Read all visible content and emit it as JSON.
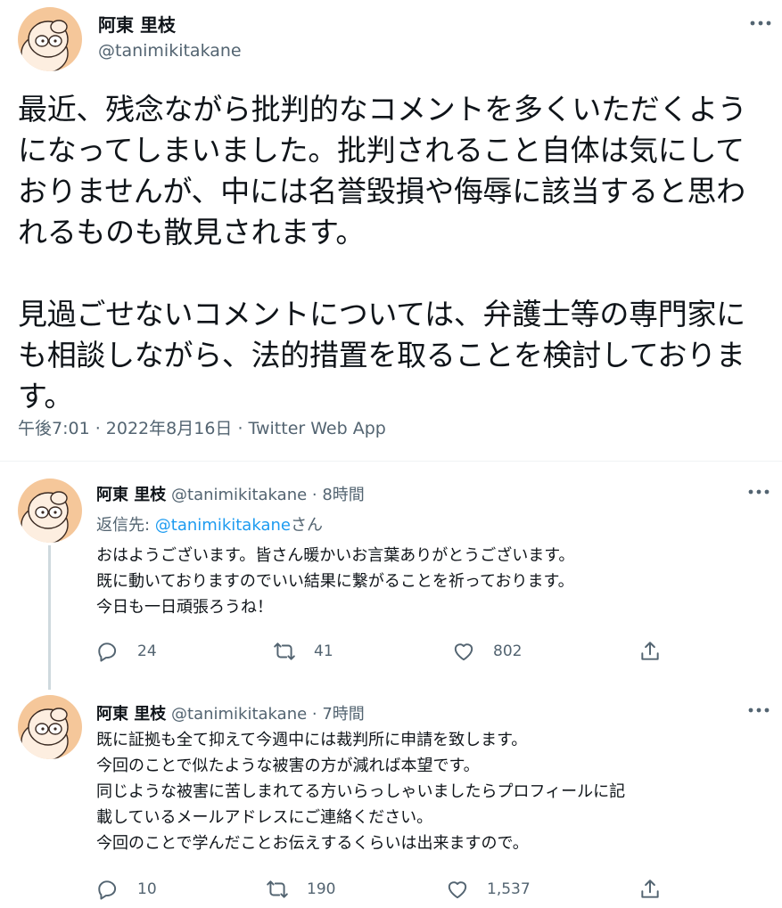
{
  "main_tweet": {
    "author_name": "阿東 里枝",
    "author_handle": "@tanimikitakane",
    "paragraph_1": "最近、残念ながら批判的なコメントを多くいただくようになってしまいました。批判されること自体は気にしておりませんが、中には名誉毀損や侮辱に該当すると思われるものも散見されます。",
    "paragraph_2": "見過ごせないコメントについては、弁護士等の専門家にも相談しながら、法的措置を取ることを検討しております。",
    "meta": "午後7:01 · 2022年8月16日 · Twitter Web App"
  },
  "replies": [
    {
      "author_name": "阿東 里枝",
      "author_handle_time": "@tanimikitakane · 8時間",
      "reply_to_prefix": "返信先: ",
      "reply_to_mention": "@tanimikitakane",
      "reply_to_suffix": "さん",
      "lines": [
        "おはようございます。皆さん暖かいお言葉ありがとうございます。",
        "既に動いておりますのでいい結果に繋がることを祈っております。",
        "今日も一日頑張ろうね！"
      ],
      "reply_count": "24",
      "retweet_count": "41",
      "like_count": "802"
    },
    {
      "author_name": "阿東 里枝",
      "author_handle_time": "@tanimikitakane · 7時間",
      "lines": [
        "既に証拠も全て抑えて今週中には裁判所に申請を致します。",
        "今回のことで似たような被害の方が減れば本望です。",
        "同じような被害に苦しまれてる方いらっしゃいましたらプロフィールに記",
        "載しているメールアドレスにご連絡ください。",
        "今回のことで学んだことお伝えするくらいは出来ますので。"
      ],
      "reply_count": "10",
      "retweet_count": "190",
      "like_count": "1,537"
    }
  ],
  "colors": {
    "text_primary": "#0f1419",
    "text_secondary": "#536471",
    "link": "#1d9bf0",
    "avatar_bg": "#f5c79a",
    "divider": "#eff3f4"
  },
  "icons": [
    "avatar-icon",
    "more-options-icon",
    "reply-icon",
    "retweet-icon",
    "like-icon",
    "share-icon"
  ]
}
